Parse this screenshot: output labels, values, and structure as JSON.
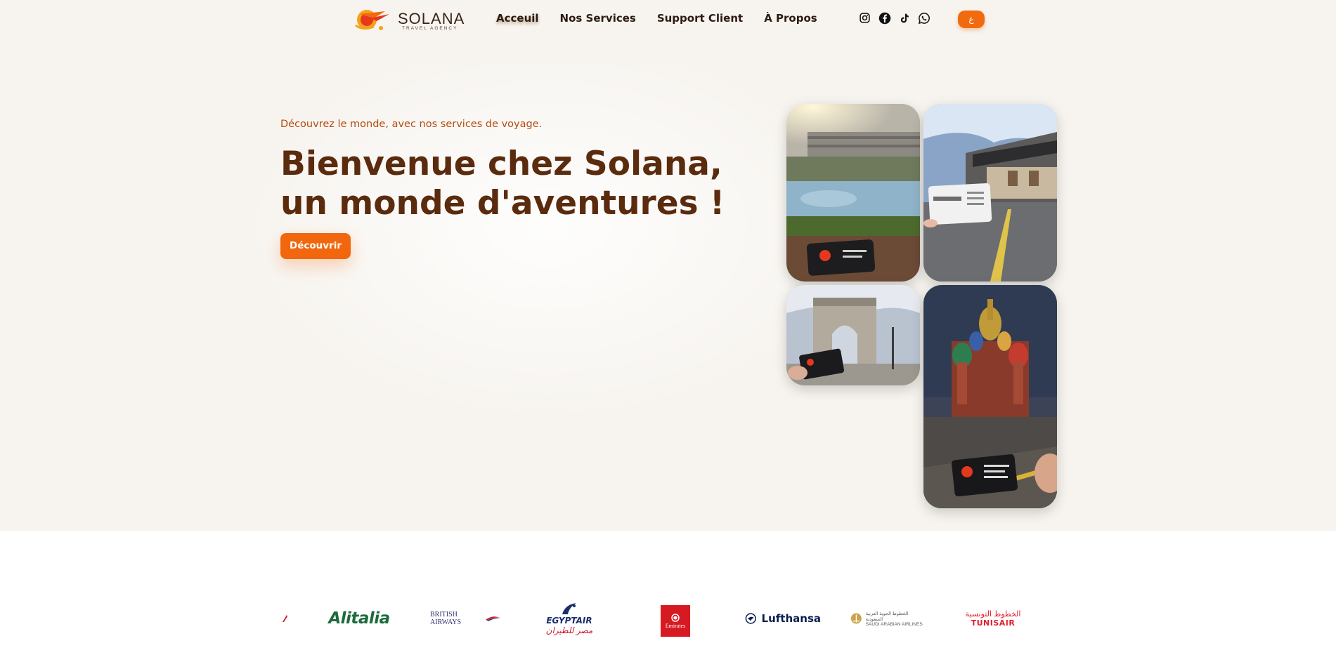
{
  "brand": {
    "name": "SOLANA",
    "subtitle": "TRAVEL AGENCY",
    "accent_color": "#f26a0f",
    "headline_color": "#5b2b0e"
  },
  "nav": {
    "items": [
      {
        "label": "Acceuil",
        "active": true
      },
      {
        "label": "Nos Services",
        "active": false
      },
      {
        "label": "Support Client",
        "active": false
      },
      {
        "label": "À Propos",
        "active": false
      }
    ]
  },
  "social": {
    "icons": [
      "instagram-icon",
      "facebook-icon",
      "tiktok-icon",
      "whatsapp-icon"
    ]
  },
  "language_button": {
    "label": "ع"
  },
  "hero": {
    "tagline": "Découvrez le monde, avec nos services de voyage.",
    "headline_line1": "Bienvenue chez Solana,",
    "headline_line2": "un monde d'aventures !",
    "cta_label": "Découvrir"
  },
  "gallery": {
    "photos": [
      "resort-pool-photo",
      "korean-village-photo",
      "arc-de-triomphe-photo",
      "saint-basil-cathedral-photo"
    ]
  },
  "partners": {
    "alitalia": "Alitalia",
    "british_airways": "BRITISH AIRWAYS",
    "egyptair_en": "EGYPTAIR",
    "egyptair_ar": "مصر للطيران",
    "emirates": "Emirates",
    "lufthansa": "Lufthansa",
    "saudia_ar": "الخطوط الجوية العربية السعودية",
    "saudia_en": "SAUDI ARABIAN AIRLINES",
    "tunisair_ar": "الخطوط التونسية",
    "tunisair_en": "TUNISAIR"
  }
}
